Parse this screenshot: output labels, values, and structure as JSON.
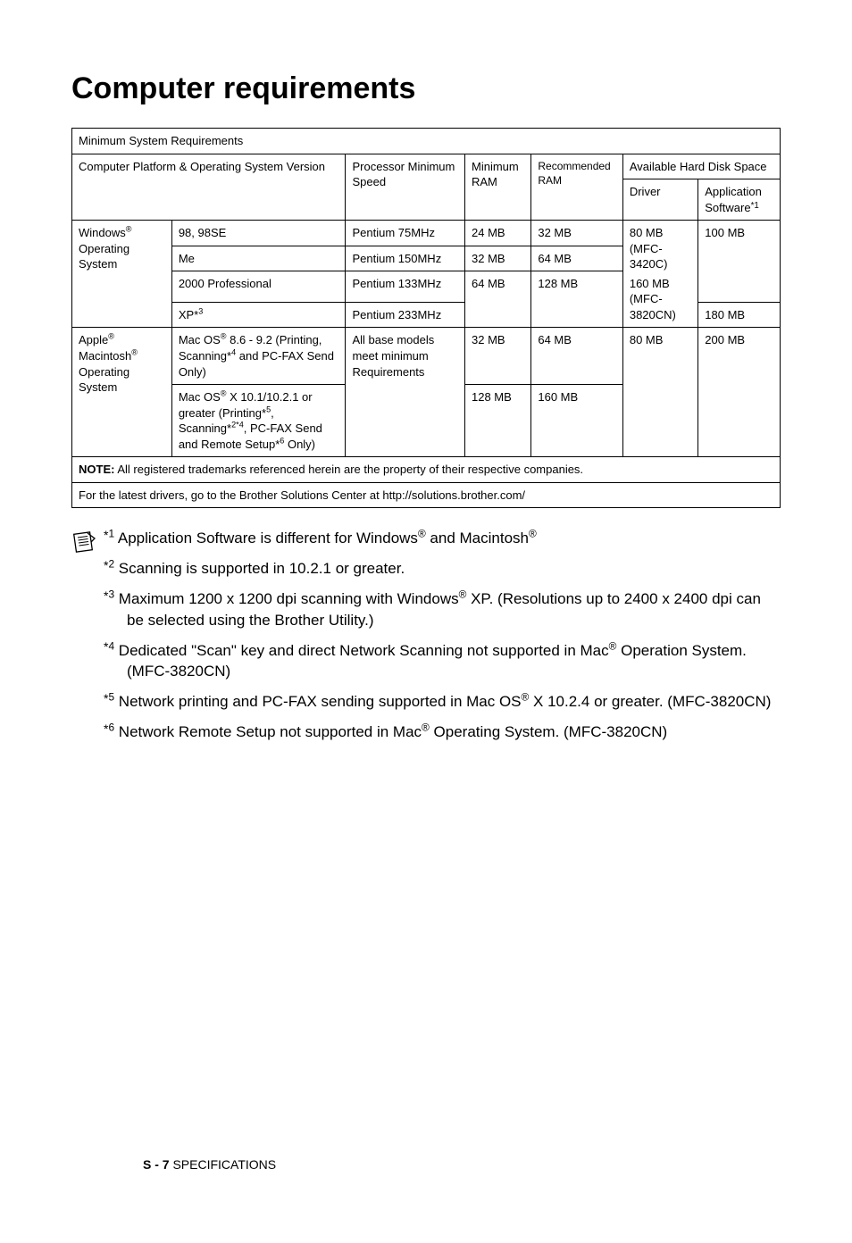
{
  "title": "Computer requirements",
  "table": {
    "caption": "Minimum System Requirements",
    "h_platform": "Computer Platform & Operating System Version",
    "h_proc": "Processor Minimum Speed",
    "h_minram": "Minimum RAM",
    "h_recram": "Recommended RAM",
    "h_hdd": "Available Hard Disk Space",
    "h_driver": "Driver",
    "h_app": "Application Software",
    "h_app_sup": "*1",
    "win_group": "Windows® Operating System",
    "win_group_pre": "Windows",
    "win_group_suf": " Operating System",
    "win_r1_os": "98, 98SE",
    "win_r1_proc": "Pentium 75MHz",
    "win_r1_min": "24 MB",
    "win_r1_rec": "32 MB",
    "win_r2_os": "Me",
    "win_r2_proc": "Pentium 150MHz",
    "win_r2_min": "32 MB",
    "win_r2_rec": "64 MB",
    "win_r3_os": "2000 Professional",
    "win_r3_proc": "Pentium 133MHz",
    "win_r3_min": "64 MB",
    "win_r3_rec": "128 MB",
    "win_r4_os_pre": "XP*",
    "win_r4_os_sup": "3",
    "win_r4_proc": "Pentium 233MHz",
    "win_drv_a": "80 MB (MFC-3420C)",
    "win_drv_b": "160 MB (MFC-3820CN)",
    "win_app_a": "100 MB",
    "win_app_b": "180 MB",
    "mac_group_a": "Apple",
    "mac_group_b": " Macintosh",
    "mac_group_c": " Operating System",
    "mac_r1_os_a": "Mac OS",
    "mac_r1_os_b": " 8.6 - 9.2 (Printing, Scanning*",
    "mac_r1_os_s1": "4",
    "mac_r1_os_c": " and PC-FAX Send Only)",
    "mac_r1_min": "32 MB",
    "mac_r1_rec": "64 MB",
    "mac_r2_os_a": "Mac OS",
    "mac_r2_os_b": " X 10.1/10.2.1 or greater (Printing*",
    "mac_r2_s5": "5",
    "mac_r2_os_c": ", Scanning*",
    "mac_r2_s24": "2*4",
    "mac_r2_os_d": ", PC-FAX Send and Remote Setup*",
    "mac_r2_s6": "6",
    "mac_r2_os_e": " Only)",
    "mac_r2_min": "128 MB",
    "mac_r2_rec": "160 MB",
    "mac_proc": "All base models meet minimum Requirements",
    "mac_drv": "80 MB",
    "mac_app": "200 MB",
    "note_row_pre": "NOTE:",
    "note_row_txt": " All registered trademarks referenced herein are the property of their respective companies.",
    "latest_row": "For the latest drivers, go to the Brother Solutions Center at http://solutions.brother.com/"
  },
  "footnotes": {
    "f1_a": "*",
    "f1_s": "1",
    "f1_b": " Application Software is different for Windows",
    "f1_c": " and Macintosh",
    "f2_a": "*",
    "f2_s": "2",
    "f2_b": " Scanning is supported in 10.2.1 or greater.",
    "f3_a": "*",
    "f3_s": "3",
    "f3_b": " Maximum 1200 x 1200 dpi scanning with Windows",
    "f3_c": " XP. (Resolutions up to 2400 x 2400 dpi can be selected using the Brother Utility.)",
    "f4_a": "*",
    "f4_s": "4",
    "f4_b": " Dedicated \"Scan\" key and direct Network Scanning not supported in Mac",
    "f4_c": " Operation System. (MFC-3820CN)",
    "f5_a": "*",
    "f5_s": "5",
    "f5_b": " Network printing and PC-FAX sending supported in Mac OS",
    "f5_c": " X 10.2.4 or greater. (MFC-3820CN)",
    "f6_a": "*",
    "f6_s": "6",
    "f6_b": " Network Remote Setup not supported in Mac",
    "f6_c": " Operating System. (MFC-3820CN)"
  },
  "footer": {
    "page": "S - 7",
    "section": "   SPECIFICATIONS"
  }
}
